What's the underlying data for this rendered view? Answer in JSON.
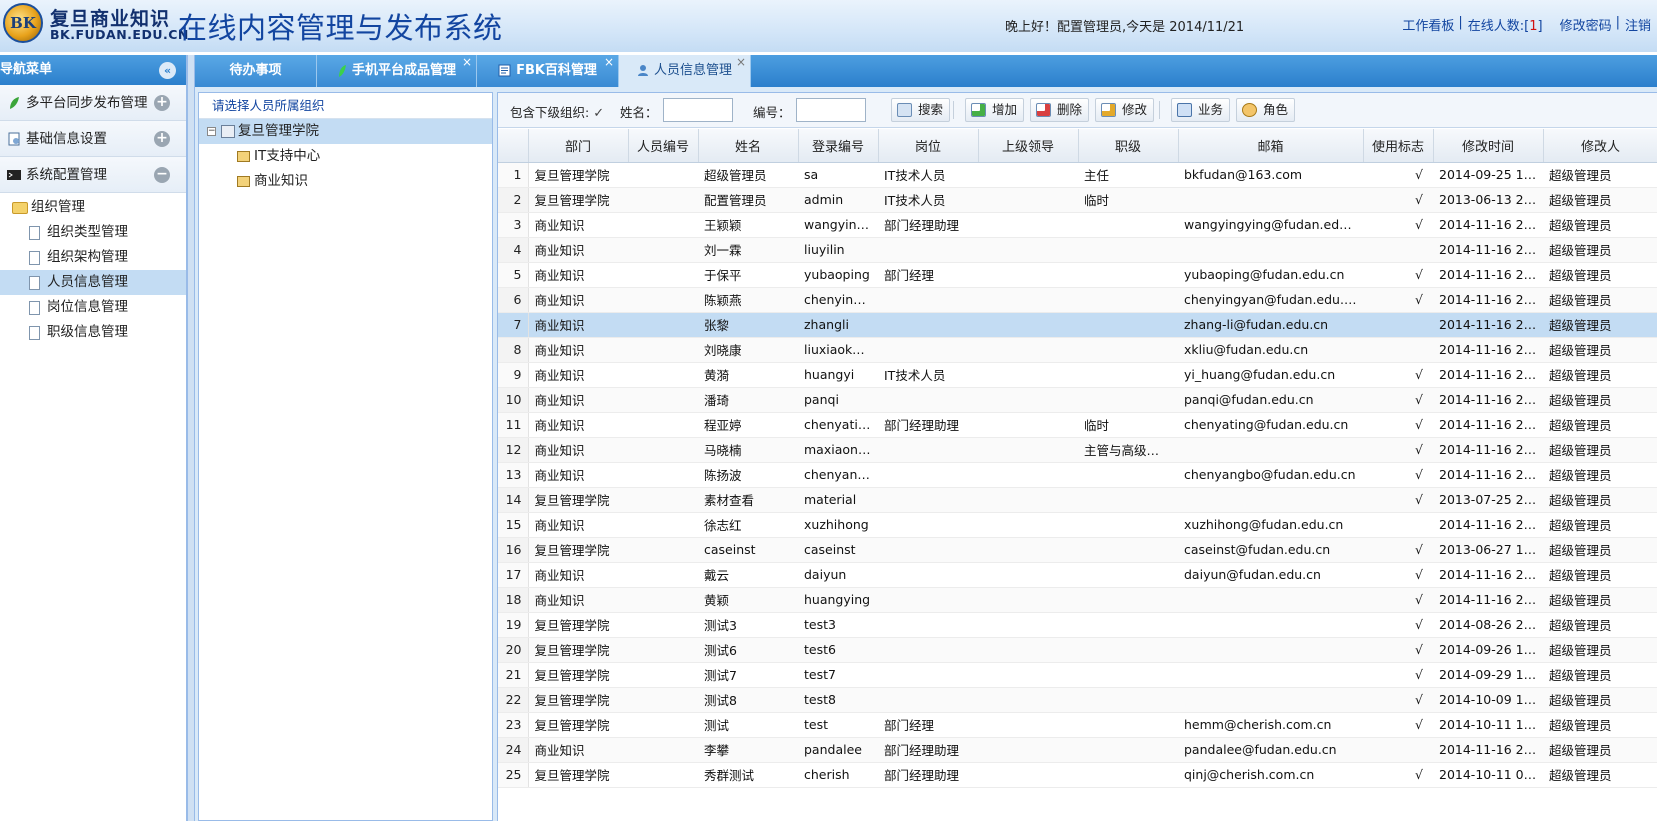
{
  "header": {
    "logo_mark": "BK",
    "logo_cn": "复旦商业知识",
    "logo_en": "BK.FUDAN.EDU.CN",
    "system_title": "在线内容管理与发布系统",
    "greeting": "晚上好！配置管理员,今天是 2014/11/21",
    "links": {
      "dashboard": "工作看板",
      "online_prefix": "在线人数:[",
      "online_count": "1",
      "online_suffix": "]",
      "change_password": "修改密码",
      "logout": "注销",
      "sep": "|"
    }
  },
  "nav": {
    "title": "导航菜单",
    "collapse_glyph": "«",
    "sections": [
      {
        "label": "多平台同步发布管理",
        "toggle": "+"
      },
      {
        "label": "基础信息设置",
        "toggle": "+"
      },
      {
        "label": "系统配置管理",
        "toggle": "−"
      }
    ],
    "tree_root": "组织管理",
    "tree_items": [
      "组织类型管理",
      "组织架构管理",
      "人员信息管理",
      "岗位信息管理",
      "职级信息管理"
    ]
  },
  "tabs": [
    {
      "label": "待办事项"
    },
    {
      "label": "手机平台成品管理",
      "close": "×"
    },
    {
      "label": "FBK百科管理",
      "close": "×"
    },
    {
      "label": "人员信息管理",
      "close": "×"
    }
  ],
  "org": {
    "title": "请选择人员所属组织",
    "root": "复旦管理学院",
    "children": [
      "IT支持中心",
      "商业知识"
    ]
  },
  "toolbar": {
    "include_sub_label": "包含下级组织:",
    "include_sub_checked": "✓",
    "name_label": "姓名：",
    "name_value": "",
    "code_label": "编号：",
    "code_value": "",
    "buttons": {
      "search": "搜索",
      "add": "增加",
      "delete": "删除",
      "edit": "修改",
      "business": "业务",
      "role": "角色"
    }
  },
  "grid": {
    "columns": [
      "",
      "部门",
      "人员编号",
      "姓名",
      "登录编号",
      "岗位",
      "上级领导",
      "职级",
      "邮箱",
      "使用标志",
      "修改时间",
      "修改人"
    ],
    "rows": [
      [
        "1",
        "复旦管理学院",
        "",
        "超级管理员",
        "sa",
        "IT技术人员",
        "",
        "主任",
        "bkfudan@163.com",
        "√",
        "2014-09-25 14…",
        "超级管理员"
      ],
      [
        "2",
        "复旦管理学院",
        "",
        "配置管理员",
        "admin",
        "IT技术人员",
        "",
        "临时",
        "",
        "√",
        "2013-06-13 22…",
        "超级管理员"
      ],
      [
        "3",
        "商业知识",
        "",
        "王颖颖",
        "wangying…",
        "部门经理助理",
        "",
        "",
        "wangyingying@fudan.edu.cn",
        "√",
        "2014-11-16 21…",
        "超级管理员"
      ],
      [
        "4",
        "商业知识",
        "",
        "刘一霖",
        "liuyilin",
        "",
        "",
        "",
        "",
        "",
        "2014-11-16 21…",
        "超级管理员"
      ],
      [
        "5",
        "商业知识",
        "",
        "于保平",
        "yubaoping",
        "部门经理",
        "",
        "",
        "yubaoping@fudan.edu.cn",
        "√",
        "2014-11-16 21…",
        "超级管理员"
      ],
      [
        "6",
        "商业知识",
        "",
        "陈颖燕",
        "chenying…",
        "",
        "",
        "",
        "chenyingyan@fudan.edu.cn",
        "√",
        "2014-11-16 21…",
        "超级管理员"
      ],
      [
        "7",
        "商业知识",
        "",
        "张黎",
        "zhangli",
        "",
        "",
        "",
        "zhang-li@fudan.edu.cn",
        "",
        "2014-11-16 21…",
        "超级管理员"
      ],
      [
        "8",
        "商业知识",
        "",
        "刘晓康",
        "liuxiaokang",
        "",
        "",
        "",
        "xkliu@fudan.edu.cn",
        "",
        "2014-11-16 21…",
        "超级管理员"
      ],
      [
        "9",
        "商业知识",
        "",
        "黄漪",
        "huangyi",
        "IT技术人员",
        "",
        "",
        "yi_huang@fudan.edu.cn",
        "√",
        "2014-11-16 21…",
        "超级管理员"
      ],
      [
        "10",
        "商业知识",
        "",
        "潘琦",
        "panqi",
        "",
        "",
        "",
        "panqi@fudan.edu.cn",
        "√",
        "2014-11-16 21…",
        "超级管理员"
      ],
      [
        "11",
        "商业知识",
        "",
        "程亚婷",
        "chenyating",
        "部门经理助理",
        "",
        "临时",
        "chenyating@fudan.edu.cn",
        "√",
        "2014-11-16 21…",
        "超级管理员"
      ],
      [
        "12",
        "商业知识",
        "",
        "马晓楠",
        "maxiaonan",
        "",
        "",
        "主管与高级…",
        "",
        "√",
        "2014-11-16 21…",
        "超级管理员"
      ],
      [
        "13",
        "商业知识",
        "",
        "陈扬波",
        "chenyan…",
        "",
        "",
        "",
        "chenyangbo@fudan.edu.cn",
        "√",
        "2014-11-16 21…",
        "超级管理员"
      ],
      [
        "14",
        "复旦管理学院",
        "",
        "素材查看",
        "material",
        "",
        "",
        "",
        "",
        "√",
        "2013-07-25 23…",
        "超级管理员"
      ],
      [
        "15",
        "商业知识",
        "",
        "徐志红",
        "xuzhihong",
        "",
        "",
        "",
        "xuzhihong@fudan.edu.cn",
        "",
        "2014-11-16 21…",
        "超级管理员"
      ],
      [
        "16",
        "复旦管理学院",
        "",
        "caseinst",
        "caseinst",
        "",
        "",
        "",
        "caseinst@fudan.edu.cn",
        "√",
        "2013-06-27 16…",
        "超级管理员"
      ],
      [
        "17",
        "商业知识",
        "",
        "戴云",
        "daiyun",
        "",
        "",
        "",
        "daiyun@fudan.edu.cn",
        "√",
        "2014-11-16 21…",
        "超级管理员"
      ],
      [
        "18",
        "商业知识",
        "",
        "黄颖",
        "huangying",
        "",
        "",
        "",
        "",
        "√",
        "2014-11-16 21…",
        "超级管理员"
      ],
      [
        "19",
        "复旦管理学院",
        "",
        "测试3",
        "test3",
        "",
        "",
        "",
        "",
        "√",
        "2014-08-26 21…",
        "超级管理员"
      ],
      [
        "20",
        "复旦管理学院",
        "",
        "测试6",
        "test6",
        "",
        "",
        "",
        "",
        "√",
        "2014-09-26 11…",
        "超级管理员"
      ],
      [
        "21",
        "复旦管理学院",
        "",
        "测试7",
        "test7",
        "",
        "",
        "",
        "",
        "√",
        "2014-09-29 16…",
        "超级管理员"
      ],
      [
        "22",
        "复旦管理学院",
        "",
        "测试8",
        "test8",
        "",
        "",
        "",
        "",
        "√",
        "2014-10-09 15…",
        "超级管理员"
      ],
      [
        "23",
        "复旦管理学院",
        "",
        "测试",
        "test",
        "部门经理",
        "",
        "",
        "hemm@cherish.com.cn",
        "√",
        "2014-10-11 16…",
        "超级管理员"
      ],
      [
        "24",
        "商业知识",
        "",
        "李攀",
        "pandalee",
        "部门经理助理",
        "",
        "",
        "pandalee@fudan.edu.cn",
        "",
        "2014-11-16 21…",
        "超级管理员"
      ],
      [
        "25",
        "复旦管理学院",
        "",
        "秀群测试",
        "cherish",
        "部门经理助理",
        "",
        "",
        "qinj@cherish.com.cn",
        "√",
        "2014-10-11 09…",
        "超级管理员"
      ]
    ],
    "selected_row": 7
  },
  "colors": {
    "primary_blue": "#2b7fcc",
    "selection": "#c3dcf3",
    "link": "#1245a0",
    "alert_red": "#d01010"
  }
}
